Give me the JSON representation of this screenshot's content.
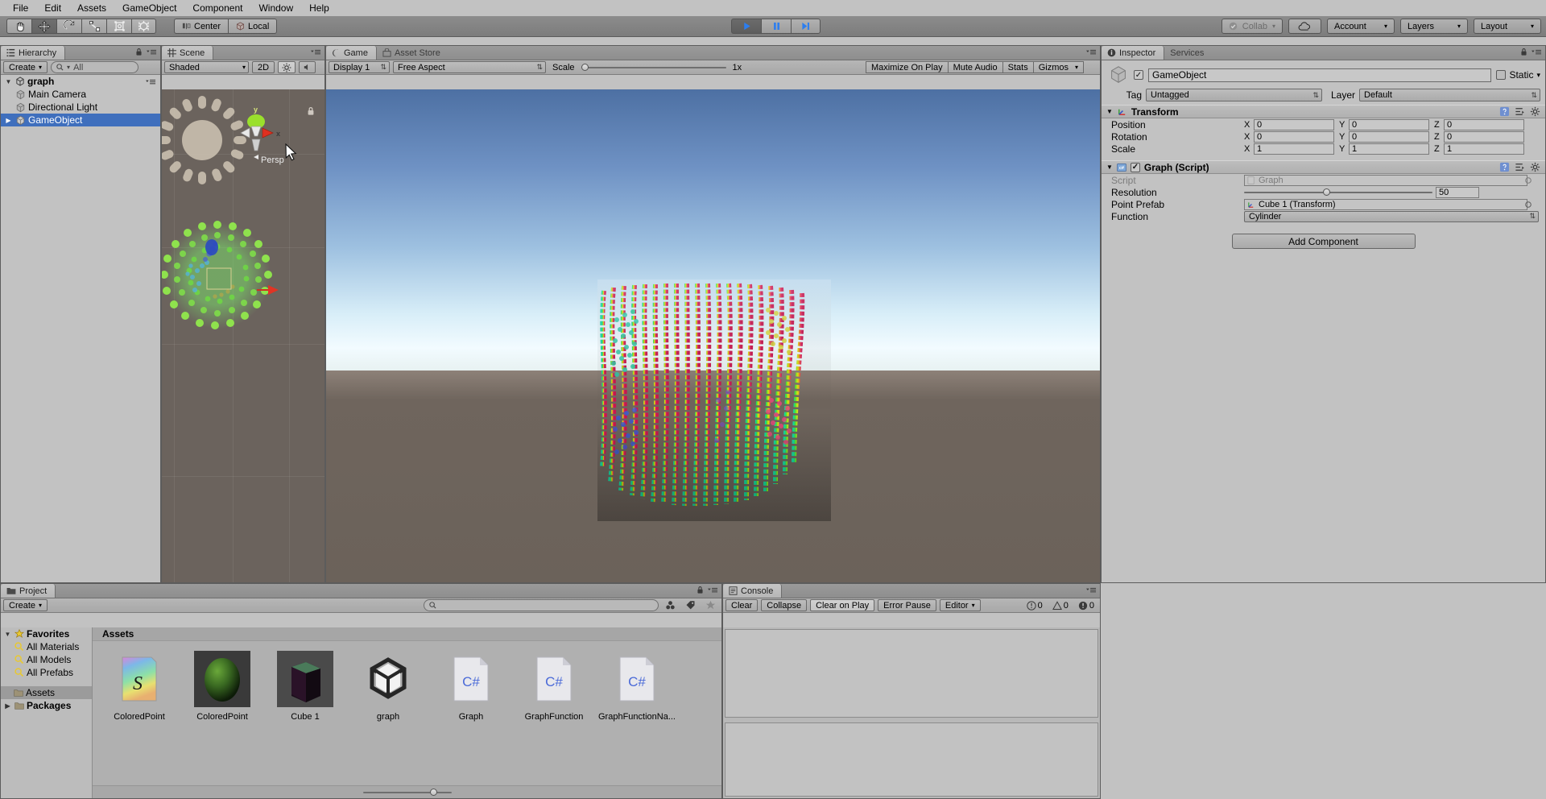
{
  "menu": {
    "items": [
      "File",
      "Edit",
      "Assets",
      "GameObject",
      "Component",
      "Window",
      "Help"
    ]
  },
  "toolbar": {
    "tools": [
      "hand-tool",
      "move-tool",
      "rotate-tool",
      "scale-tool",
      "rect-tool",
      "transform-tool"
    ],
    "active_tool_index": 1,
    "pivot_label": "Center",
    "space_label": "Local",
    "play_label": "play",
    "pause_label": "pause",
    "step_label": "step",
    "collab_label": "Collab",
    "cloud_label": "cloud",
    "account_label": "Account",
    "layers_label": "Layers",
    "layout_label": "Layout"
  },
  "hierarchy": {
    "tab_label": "Hierarchy",
    "create_label": "Create",
    "search_placeholder": "All",
    "search_value": "",
    "scene_name": "graph",
    "items": [
      {
        "label": "Main Camera",
        "selected": false,
        "expandable": false
      },
      {
        "label": "Directional Light",
        "selected": false,
        "expandable": false
      },
      {
        "label": "GameObject",
        "selected": true,
        "expandable": true
      }
    ]
  },
  "scene": {
    "tab_label": "Scene",
    "shading_label": "Shaded",
    "twod_label": "2D",
    "gizmo_axis_x": "x",
    "gizmo_axis_y": "y",
    "perspective_label": "Persp"
  },
  "game": {
    "tab_label": "Game",
    "asset_store_tab": "Asset Store",
    "display_label": "Display 1",
    "aspect_label": "Free Aspect",
    "scale_label": "Scale",
    "scale_value": "1x",
    "maximize_label": "Maximize On Play",
    "mute_label": "Mute Audio",
    "stats_label": "Stats",
    "gizmos_label": "Gizmos"
  },
  "inspector": {
    "tab_label": "Inspector",
    "services_tab": "Services",
    "object_name": "GameObject",
    "object_enabled": true,
    "static_label": "Static",
    "tag_label": "Tag",
    "tag_value": "Untagged",
    "layer_label": "Layer",
    "layer_value": "Default",
    "transform": {
      "title": "Transform",
      "rows": [
        {
          "label": "Position",
          "x": "0",
          "y": "0",
          "z": "0"
        },
        {
          "label": "Rotation",
          "x": "0",
          "y": "0",
          "z": "0"
        },
        {
          "label": "Scale",
          "x": "1",
          "y": "1",
          "z": "1"
        }
      ],
      "axis_x": "X",
      "axis_y": "Y",
      "axis_z": "Z"
    },
    "graph_script": {
      "title": "Graph (Script)",
      "enabled": true,
      "script_label": "Script",
      "script_value": "Graph",
      "resolution_label": "Resolution",
      "resolution_value": "50",
      "resolution_percent": 42,
      "point_prefab_label": "Point Prefab",
      "point_prefab_value": "Cube 1 (Transform)",
      "function_label": "Function",
      "function_value": "Cylinder"
    },
    "add_component_label": "Add Component"
  },
  "project": {
    "tab_label": "Project",
    "create_label": "Create",
    "search_placeholder": "",
    "search_value": "",
    "tree": [
      {
        "label": "Favorites",
        "type": "root",
        "selected": false
      },
      {
        "label": "All Materials",
        "type": "search",
        "selected": false
      },
      {
        "label": "All Models",
        "type": "search",
        "selected": false
      },
      {
        "label": "All Prefabs",
        "type": "search",
        "selected": false
      },
      {
        "label": "Assets",
        "type": "folder",
        "selected": true
      },
      {
        "label": "Packages",
        "type": "folder",
        "selected": false
      }
    ],
    "breadcrumb": "Assets",
    "assets": [
      {
        "name": "ColoredPoint",
        "kind": "shader"
      },
      {
        "name": "ColoredPoint",
        "kind": "material"
      },
      {
        "name": "Cube 1",
        "kind": "prefab"
      },
      {
        "name": "graph",
        "kind": "scene"
      },
      {
        "name": "Graph",
        "kind": "csharp"
      },
      {
        "name": "GraphFunction",
        "kind": "csharp"
      },
      {
        "name": "GraphFunctionNa...",
        "kind": "csharp"
      }
    ],
    "zoom_percent": 76
  },
  "console": {
    "tab_label": "Console",
    "clear_label": "Clear",
    "collapse_label": "Collapse",
    "clear_on_play_label": "Clear on Play",
    "error_pause_label": "Error Pause",
    "editor_label": "Editor",
    "info_count": "0",
    "warning_count": "0",
    "error_count": "0"
  },
  "colors": {
    "chrome": "#c2c2c2",
    "panel_bg": "#b0b0b0",
    "selection_blue": "#3f6fbd",
    "play_blue": "#2c7ef0",
    "axis_x": "#d83228",
    "axis_y": "#8cd916",
    "axis_z": "#2255d8"
  }
}
